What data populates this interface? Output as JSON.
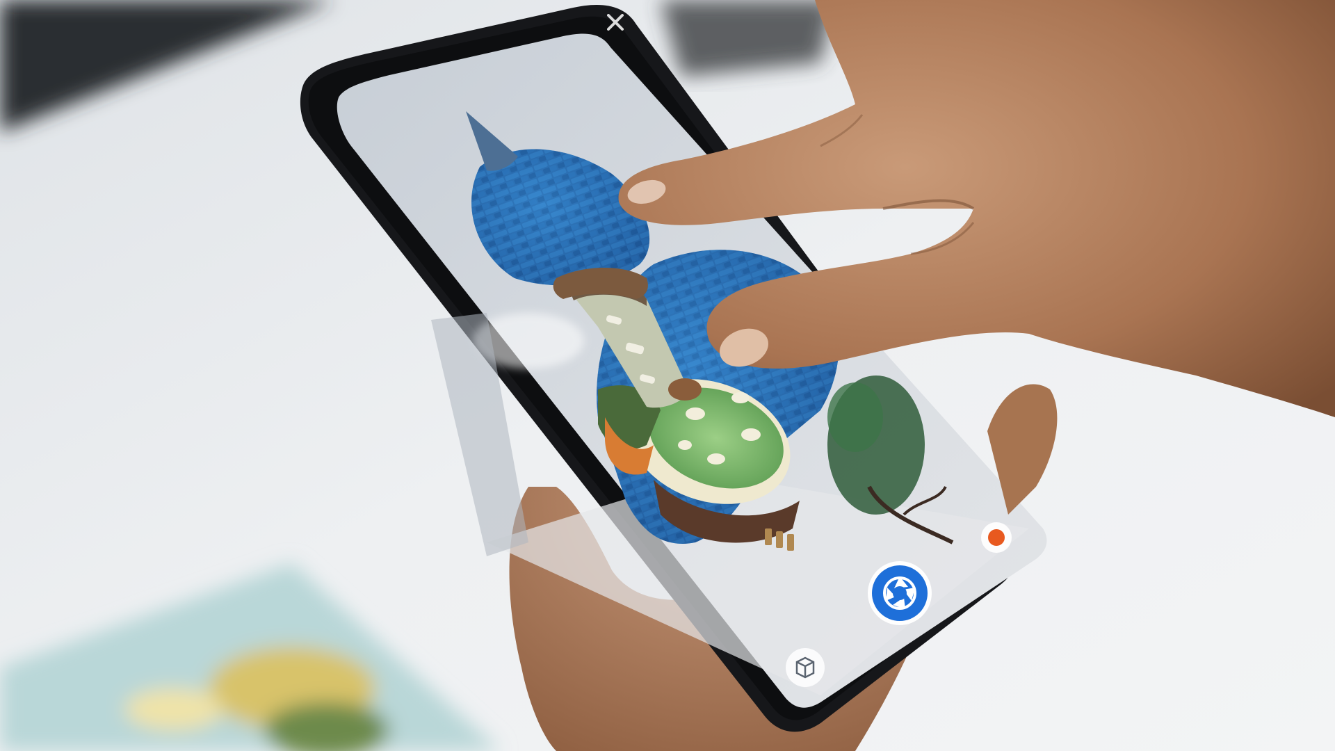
{
  "scene": {
    "description_visible_text": "",
    "phone_app": {
      "buttons": [
        {
          "name": "close",
          "icon": "close-icon"
        },
        {
          "name": "shutter",
          "icon": "camera-shutter-icon"
        },
        {
          "name": "record",
          "icon": "record-dot-icon"
        },
        {
          "name": "object-library",
          "icon": "cube-icon"
        }
      ],
      "accent_color": "#1e6fd9",
      "record_color": "#e8591f"
    }
  }
}
